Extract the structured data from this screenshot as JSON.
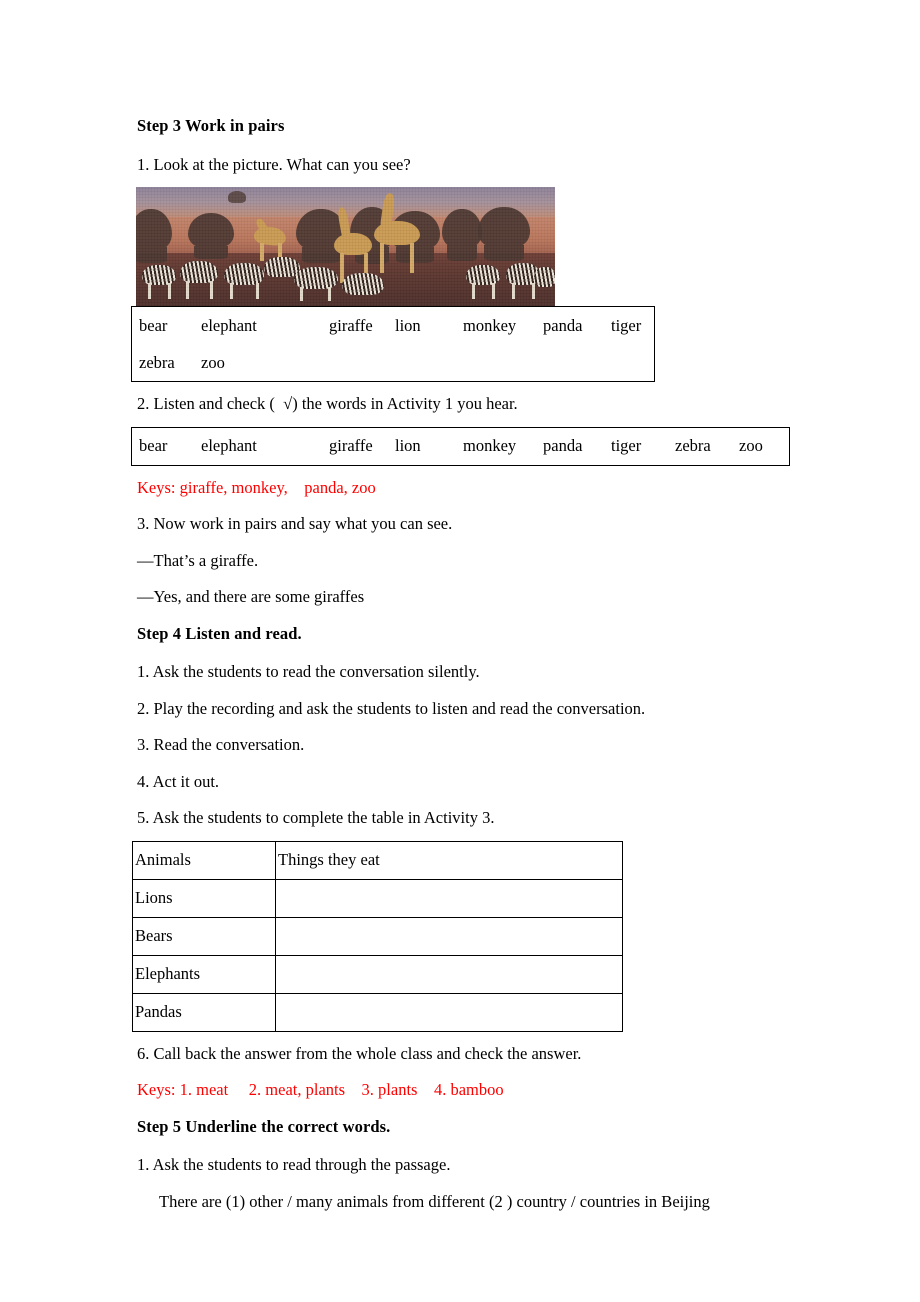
{
  "document": {
    "accent_red": "#ff0000",
    "text_color": "#000000",
    "page_background": "#ffffff"
  },
  "step3": {
    "heading": "Step 3 Work in pairs",
    "item1": "1. Look at the picture. What can you see?",
    "picture": {
      "alt": "Savanna watering hole at dusk with elephants, giraffes and zebras",
      "sky_color": "#a4909a",
      "ground_color": "#5c3730",
      "giraffe_color": "#c99a53"
    },
    "wordbox1": {
      "line1": [
        "bear",
        "elephant",
        "giraffe",
        "lion",
        "monkey",
        "panda",
        "tiger"
      ],
      "line2": [
        "zebra",
        "zoo"
      ]
    },
    "item2": "2. Listen and check (  √) the words in Activity 1 you hear.",
    "wordbox2": {
      "line1": [
        "bear",
        "elephant",
        "giraffe",
        "lion",
        "monkey",
        "panda",
        "tiger",
        "zebra",
        "zoo"
      ]
    },
    "keys1": "Keys: giraffe, monkey,    panda, zoo",
    "item3": "3. Now work in pairs and say what you can see.",
    "dialogue_a": "—That’s a giraffe.",
    "dialogue_b": "—Yes, and there are some giraffes"
  },
  "step4": {
    "heading": "Step 4 Listen and read.",
    "item1": "1. Ask the students to read the conversation silently.",
    "item2": "2. Play the recording and ask the students to listen and read the conversation.",
    "item3": "3. Read the conversation.",
    "item4": "4. Act it out.",
    "item5": "5. Ask the students to complete the table in Activity 3.",
    "table": {
      "headers": [
        "Animals",
        "Things they eat"
      ],
      "rows": [
        [
          "Lions",
          ""
        ],
        [
          "Bears",
          ""
        ],
        [
          "Elephants",
          ""
        ],
        [
          "Pandas",
          ""
        ]
      ]
    },
    "item6": "6. Call back the answer from the whole class and check the answer.",
    "keys2": "Keys: 1. meat     2. meat, plants    3. plants    4. bamboo"
  },
  "step5": {
    "heading": "Step 5 Underline the correct words.",
    "item1": "1. Ask the students to read through the passage.",
    "passage": "There are (1) other / many animals from different (2 ) country / countries in Beijing"
  }
}
